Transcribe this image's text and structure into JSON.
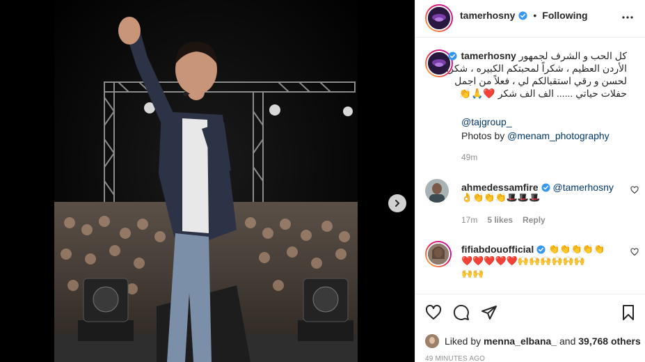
{
  "post": {
    "username": "tamerhosny",
    "separator": "•",
    "follow_status": "Following",
    "caption": {
      "username": "tamerhosny",
      "lines": [
        "كل الحب و الشرف لجمهور",
        "الأردن العظيم ، شكراً لمحبتكم الكبيره ، شكراً",
        "لحسن و رقي استقبالكم لي ، فعلاً من اجمل",
        "حفلات حياتي ...... الف الف شكر ❤️🙏👏"
      ],
      "tag": "@tajgroup_",
      "photos_by_prefix": "Photos by ",
      "photos_by_link": "@menam_photography",
      "age": "49m"
    },
    "comments": [
      {
        "username": "ahmedessamfire",
        "mention": "@tamerhosny",
        "text_lines": [
          "👌👏👏👏🎩🎩🎩"
        ],
        "age": "17m",
        "likes": "5 likes",
        "reply": "Reply"
      },
      {
        "username": "fifiabdouofficial",
        "text_inline": "👏👏👏👏👏",
        "text_lines": [
          "❤️❤️❤️❤️❤️🙌🙌🙌🙌🙌🙌",
          "🙌🙌"
        ]
      }
    ],
    "likes": {
      "prefix": "Liked by ",
      "user": "menna_elbana_",
      "middle": " and ",
      "count": "39,768 others"
    },
    "timestamp": "49 MINUTES AGO"
  },
  "colors": {
    "link": "#00376b",
    "verified": "#3897f0",
    "muted": "#8e8e8e",
    "heart": "#ed4956"
  },
  "icons": [
    "more-icon",
    "heart-icon",
    "comment-icon",
    "share-icon",
    "save-icon",
    "verified-icon",
    "chevron-right-icon"
  ]
}
